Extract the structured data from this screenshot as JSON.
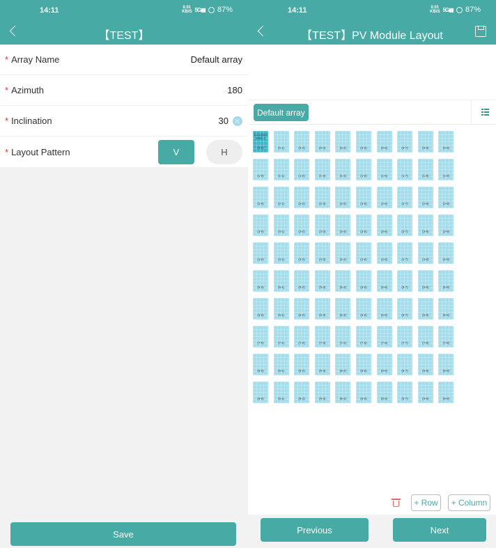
{
  "status_bar": {
    "time": "14:11",
    "net_speed": "0.01",
    "net_unit": "KB/S",
    "network": "5G",
    "battery": "87%"
  },
  "left": {
    "title": "【TEST】",
    "fields": [
      {
        "label": "Array Name",
        "value": "Default array",
        "required": true
      },
      {
        "label": "Azimuth",
        "value": "180",
        "required": true
      },
      {
        "label": "Inclination",
        "value": "30",
        "required": true
      },
      {
        "label": "Layout Pattern",
        "required": true
      }
    ],
    "layout_options": [
      "V",
      "H"
    ],
    "layout_selected": "V",
    "save_label": "Save"
  },
  "right": {
    "title": "【TEST】PV Module Layout",
    "array_chip": "Default array",
    "grid": {
      "rows": 10,
      "cols": 10,
      "selected": {
        "row": 0,
        "col": 0,
        "serial": "11214643 9461-1"
      }
    },
    "add_row_label": "+ Row",
    "add_column_label": "+ Column",
    "previous_label": "Previous",
    "next_label": "Next"
  }
}
